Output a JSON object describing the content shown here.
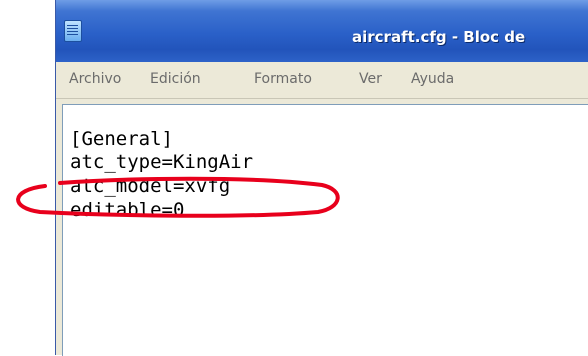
{
  "window": {
    "title": "aircraft.cfg - Bloc de"
  },
  "menu": [
    "Archivo",
    "Edición",
    "Formato",
    "Ver",
    "Ayuda"
  ],
  "document": {
    "lines": [
      "[General]",
      "atc_type=KingAir",
      "atc_model=xvfg",
      "editable=0"
    ]
  },
  "annotation": {
    "color": "#e8001c",
    "highlighted_line": "atc_model=xvfg"
  }
}
